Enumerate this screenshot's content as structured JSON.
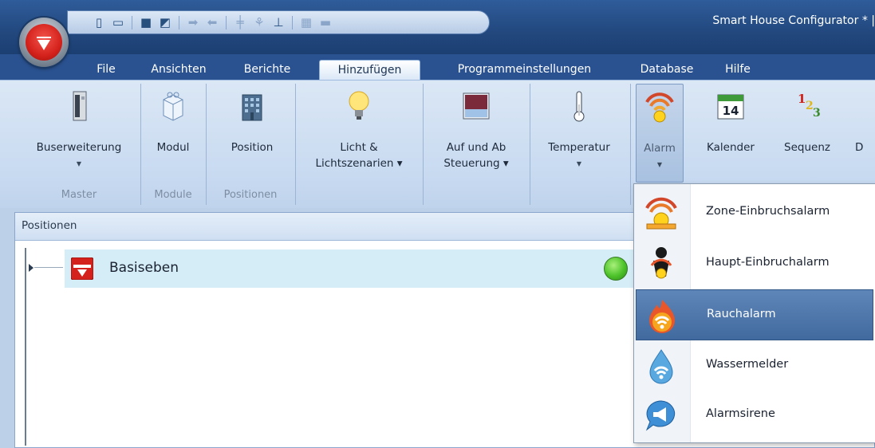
{
  "window": {
    "title": "Smart House Configurator * |"
  },
  "quick_access": {
    "icons": [
      "new-document-icon",
      "printer-icon",
      "save-icon",
      "edit-icon",
      "import-icon",
      "export-icon",
      "tower-icon",
      "antenna-icon",
      "network-icon",
      "color-icon",
      "monitor-icon"
    ]
  },
  "tabs": [
    {
      "label": "File"
    },
    {
      "label": "Ansichten"
    },
    {
      "label": "Berichte"
    },
    {
      "label": "Hinzufügen",
      "active": true
    },
    {
      "label": "Programmeinstellungen"
    },
    {
      "label": "Database"
    },
    {
      "label": "Hilfe"
    }
  ],
  "ribbon": {
    "groups": [
      {
        "label": "Master"
      },
      {
        "label": "Module"
      },
      {
        "label": "Positionen"
      }
    ],
    "buttons": [
      {
        "label": "Buserweiterung",
        "has_arrow": true,
        "icon": "bus-extension-icon"
      },
      {
        "label": "Modul",
        "has_arrow": false,
        "icon": "module-icon"
      },
      {
        "label": "Position",
        "has_arrow": false,
        "icon": "building-icon"
      },
      {
        "label": "Licht &",
        "label2": "Lichtszenarien ▾",
        "has_arrow": false,
        "icon": "light-bulb-icon"
      },
      {
        "label": "Auf und Ab",
        "label2": "Steuerung ▾",
        "has_arrow": false,
        "icon": "blinds-icon"
      },
      {
        "label": "Temperatur",
        "has_arrow": true,
        "icon": "thermometer-icon"
      },
      {
        "label": "Alarm",
        "has_arrow": true,
        "icon": "alarm-icon",
        "pressed": true
      },
      {
        "label": "Kalender",
        "has_arrow": false,
        "icon": "calendar-icon",
        "calendar_day": "14"
      },
      {
        "label": "Sequenz",
        "has_arrow": false,
        "icon": "sequence-icon",
        "seq_digits": [
          "1",
          "2",
          "3"
        ]
      },
      {
        "label": "D",
        "has_arrow": false,
        "icon": "more-icon"
      }
    ]
  },
  "pane": {
    "title": "Positionen",
    "tree": [
      {
        "label": "Basiseben",
        "status": "online",
        "status_color": "#4cc22a"
      }
    ]
  },
  "alarm_menu": {
    "items": [
      {
        "label": "Zone-Einbruchsalarm",
        "icon": "zone-intrusion-alarm-icon"
      },
      {
        "label": "Haupt-Einbruchalarm",
        "icon": "main-intrusion-alarm-icon"
      },
      {
        "label": "Rauchalarm",
        "icon": "smoke-alarm-icon",
        "highlighted": true
      },
      {
        "label": "Wassermelder",
        "icon": "water-detector-icon"
      },
      {
        "label": "Alarmsirene",
        "icon": "alarm-siren-icon"
      }
    ]
  },
  "colors": {
    "accent": "#2a5290",
    "highlight": "#4b73a8",
    "brand_red": "#d4211b"
  }
}
